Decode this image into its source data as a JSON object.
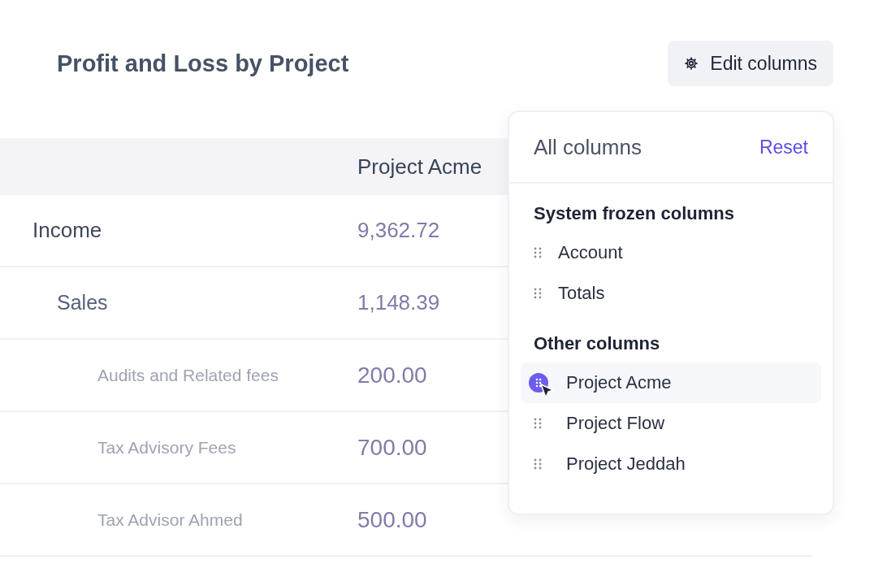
{
  "report": {
    "title": "Profit and Loss by Project",
    "edit_button": "Edit columns"
  },
  "table": {
    "columns": [
      "Project Acme"
    ],
    "rows": [
      {
        "account": "Income",
        "values": [
          "9,362.72"
        ],
        "children": [
          {
            "account": "Sales",
            "values": [
              "1,148.39"
            ],
            "children": [
              {
                "account": "Audits and Related fees",
                "values": [
                  "200.00"
                ]
              },
              {
                "account": "Tax Advisory Fees",
                "values": [
                  "700.00"
                ]
              },
              {
                "account": "Tax Advisor Ahmed",
                "values": [
                  "500.00"
                ]
              }
            ]
          }
        ]
      }
    ]
  },
  "column_menu": {
    "title": "All columns",
    "reset": "Reset",
    "sections": [
      {
        "heading": "System frozen columns",
        "items": [
          {
            "label": "Account",
            "selected": false
          },
          {
            "label": "Totals",
            "selected": false
          }
        ]
      },
      {
        "heading": "Other columns",
        "items": [
          {
            "label": "Project Acme",
            "selected": true
          },
          {
            "label": "Project Flow",
            "selected": false
          },
          {
            "label": "Project Jeddah",
            "selected": false
          }
        ]
      }
    ]
  }
}
